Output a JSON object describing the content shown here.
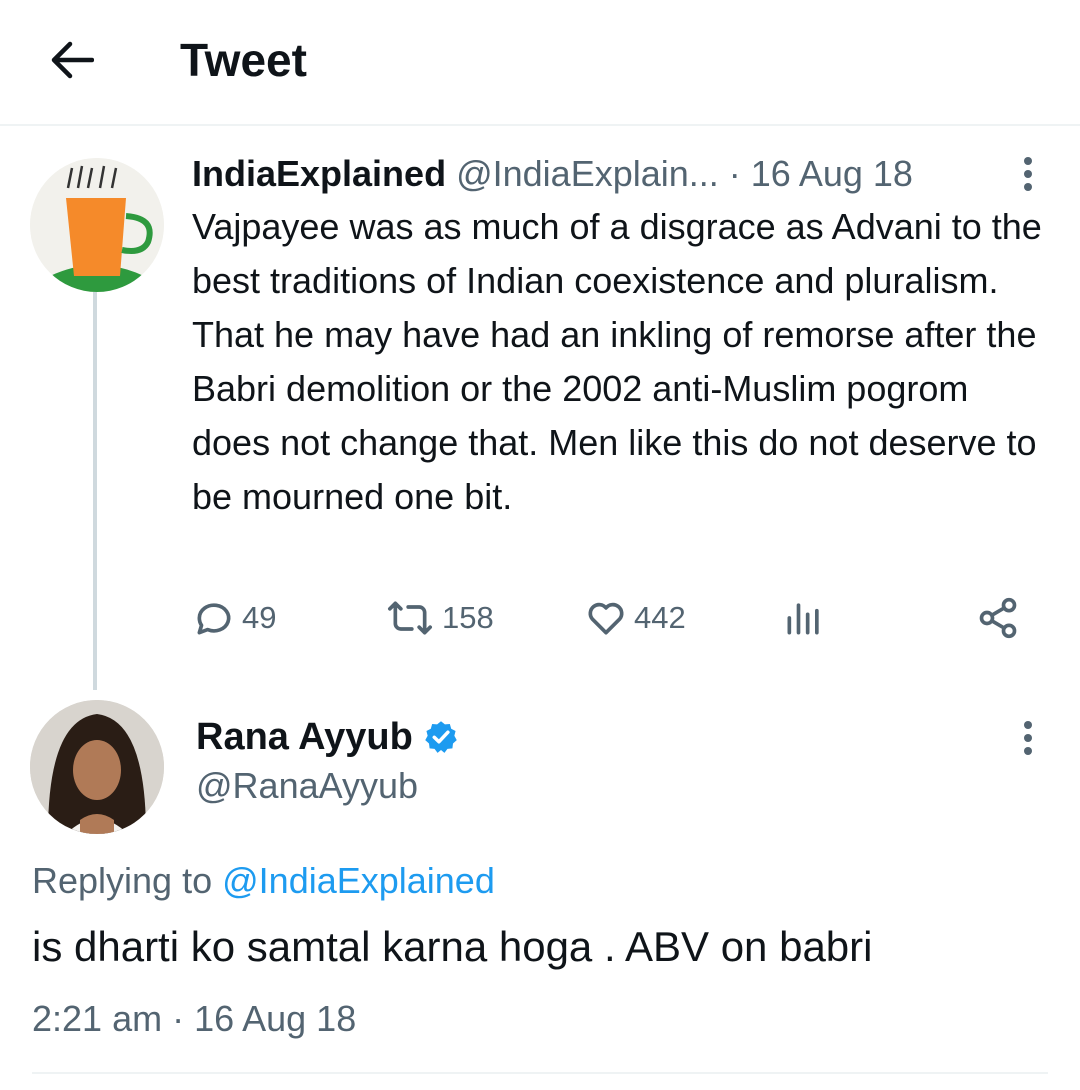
{
  "header": {
    "title": "Tweet",
    "back_icon": "arrow-left-icon"
  },
  "quoted_tweet": {
    "author_name": "IndiaExplained",
    "author_handle": "@IndiaExplain...",
    "date": "· 16 Aug 18",
    "text": "Vajpayee was as much of a disgrace as Advani to the best traditions of Indian coexistence and pluralism. That he may have had an inkling of remorse after the Babri demolition or the 2002 anti-Muslim pogrom does not change that. Men like this do not deserve to be mourned one bit.",
    "actions": {
      "replies": "49",
      "retweets": "158",
      "likes": "442"
    }
  },
  "main_tweet": {
    "author_name": "Rana Ayyub",
    "author_handle": "@RanaAyyub",
    "replying_prefix": "Replying to",
    "replying_mention": "@IndiaExplained",
    "text": "is dharti ko samtal karna hoga . ABV on babri",
    "timestamp": "2:21 am · 16 Aug 18"
  },
  "colors": {
    "text_primary": "#0f1419",
    "text_secondary": "#536471",
    "accent": "#1d9bf0",
    "divider": "#eff3f4"
  }
}
